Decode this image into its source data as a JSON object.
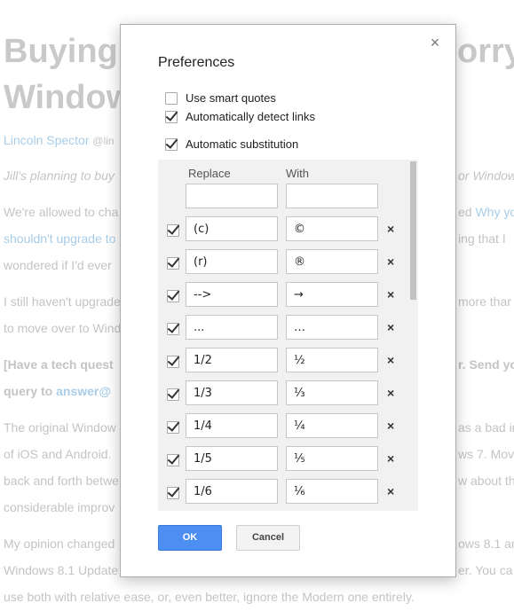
{
  "background": {
    "title_left_1": "Buying",
    "title_right_1": "orry,",
    "title_left_2": "Window",
    "author": "Lincoln Spector",
    "handle": "@lin",
    "intro_left": "Jill's planning to buy",
    "intro_right": "or Window",
    "p1_left": "We're allowed to cha",
    "p1_right_plain": "ed ",
    "p1_right_link": "Why yo",
    "p1_line2_left": "shouldn't upgrade to",
    "p1_line2_right": "ing that I",
    "p1_line3_left": "wondered if I'd ever",
    "p2_left": "I still haven't upgrade",
    "p2_right": "more thar",
    "p2_line2_left": "to move over to Wind",
    "q_left": "[Have a tech quest",
    "q_right": "r. Send yo",
    "q_line2_plain": "query to ",
    "q_line2_link": "answer@",
    "p3_left": "The original Window",
    "p3_right": "as a bad in",
    "p3_line2_left": "of iOS and Android.",
    "p3_line2_right": "ws 7. Mov",
    "p3_line3_left": "back and forth betwe",
    "p3_line3_right": "w about the",
    "p3_line4_left": "considerable improv",
    "p4_left": "My opinion changed",
    "p4_right": "ows 8.1 an",
    "p4_line2_left": "Windows 8.1 Update",
    "p4_line2_right": "er. You ca",
    "p4_line3": "use both with relative ease, or, even better, ignore the Modern one entirely."
  },
  "dialog": {
    "title": "Preferences",
    "close_glyph": "×",
    "options": [
      {
        "label": "Use smart quotes",
        "checked": false
      },
      {
        "label": "Automatically detect links",
        "checked": true
      },
      {
        "label": "Automatic substitution",
        "checked": true
      }
    ],
    "table": {
      "header_replace": "Replace",
      "header_with": "With",
      "new_replace": "",
      "new_with": "",
      "rows": [
        {
          "checked": true,
          "replace": "(c)",
          "with": "©"
        },
        {
          "checked": true,
          "replace": "(r)",
          "with": "®"
        },
        {
          "checked": true,
          "replace": "-->",
          "with": "→"
        },
        {
          "checked": true,
          "replace": "...",
          "with": "…"
        },
        {
          "checked": true,
          "replace": "1/2",
          "with": "½"
        },
        {
          "checked": true,
          "replace": "1/3",
          "with": "⅓"
        },
        {
          "checked": true,
          "replace": "1/4",
          "with": "¼"
        },
        {
          "checked": true,
          "replace": "1/5",
          "with": "⅕"
        },
        {
          "checked": true,
          "replace": "1/6",
          "with": "⅙"
        }
      ],
      "delete_glyph": "×"
    },
    "ok_label": "OK",
    "cancel_label": "Cancel"
  },
  "colors": {
    "ok_button": "#4d8ef2",
    "link": "#a8cde8",
    "panel_bg": "#f1f1f1"
  }
}
